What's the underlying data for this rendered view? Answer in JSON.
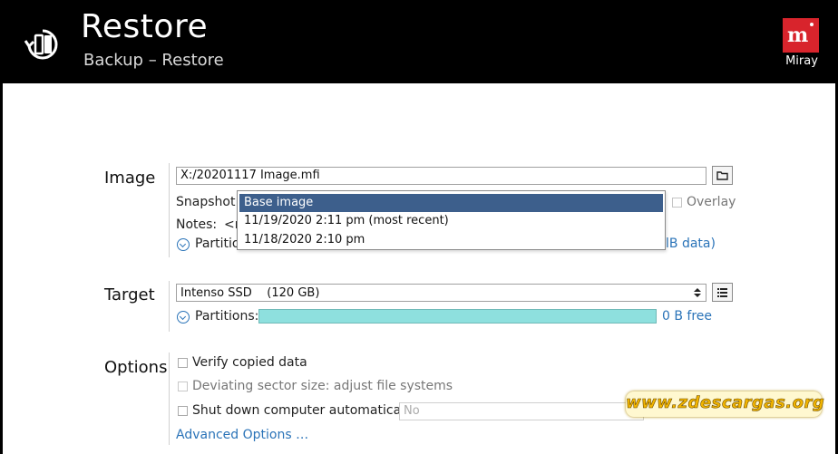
{
  "header": {
    "title": "Restore",
    "subtitle": "Backup – Restore",
    "brand": "Miray",
    "brand_logo": "mᵢ"
  },
  "image": {
    "label": "Image",
    "path": "X:/20201117 Image.mfi",
    "snapshot_label": "Snapshot:",
    "overlay_label": "Overlay",
    "notes_label": "Notes:",
    "notes_value": "<n",
    "partitions_label": "Partitio",
    "partitions_info": "lB data)",
    "snapshot_options": [
      "Base image",
      "11/19/2020 2:11 pm (most recent)",
      "11/18/2020 2:10 pm"
    ],
    "snapshot_selected": "Base image"
  },
  "target": {
    "label": "Target",
    "drive": "Intenso SSD    (120 GB)",
    "partitions_label": "Partitions:",
    "free": "0 B free",
    "bar_color": "#8ee0de"
  },
  "options": {
    "label": "Options",
    "verify": "Verify copied data",
    "deviating": "Deviating sector size: adjust file systems",
    "shutdown": "Shut down computer automatically:",
    "shutdown_value": "No",
    "advanced": "Advanced Options …"
  },
  "watermark": "www.zdescargas.org",
  "colors": {
    "accent": "#2a73b8",
    "header_bg": "#000000",
    "brand_red": "#d8242c",
    "selection": "#3d5f8c"
  }
}
